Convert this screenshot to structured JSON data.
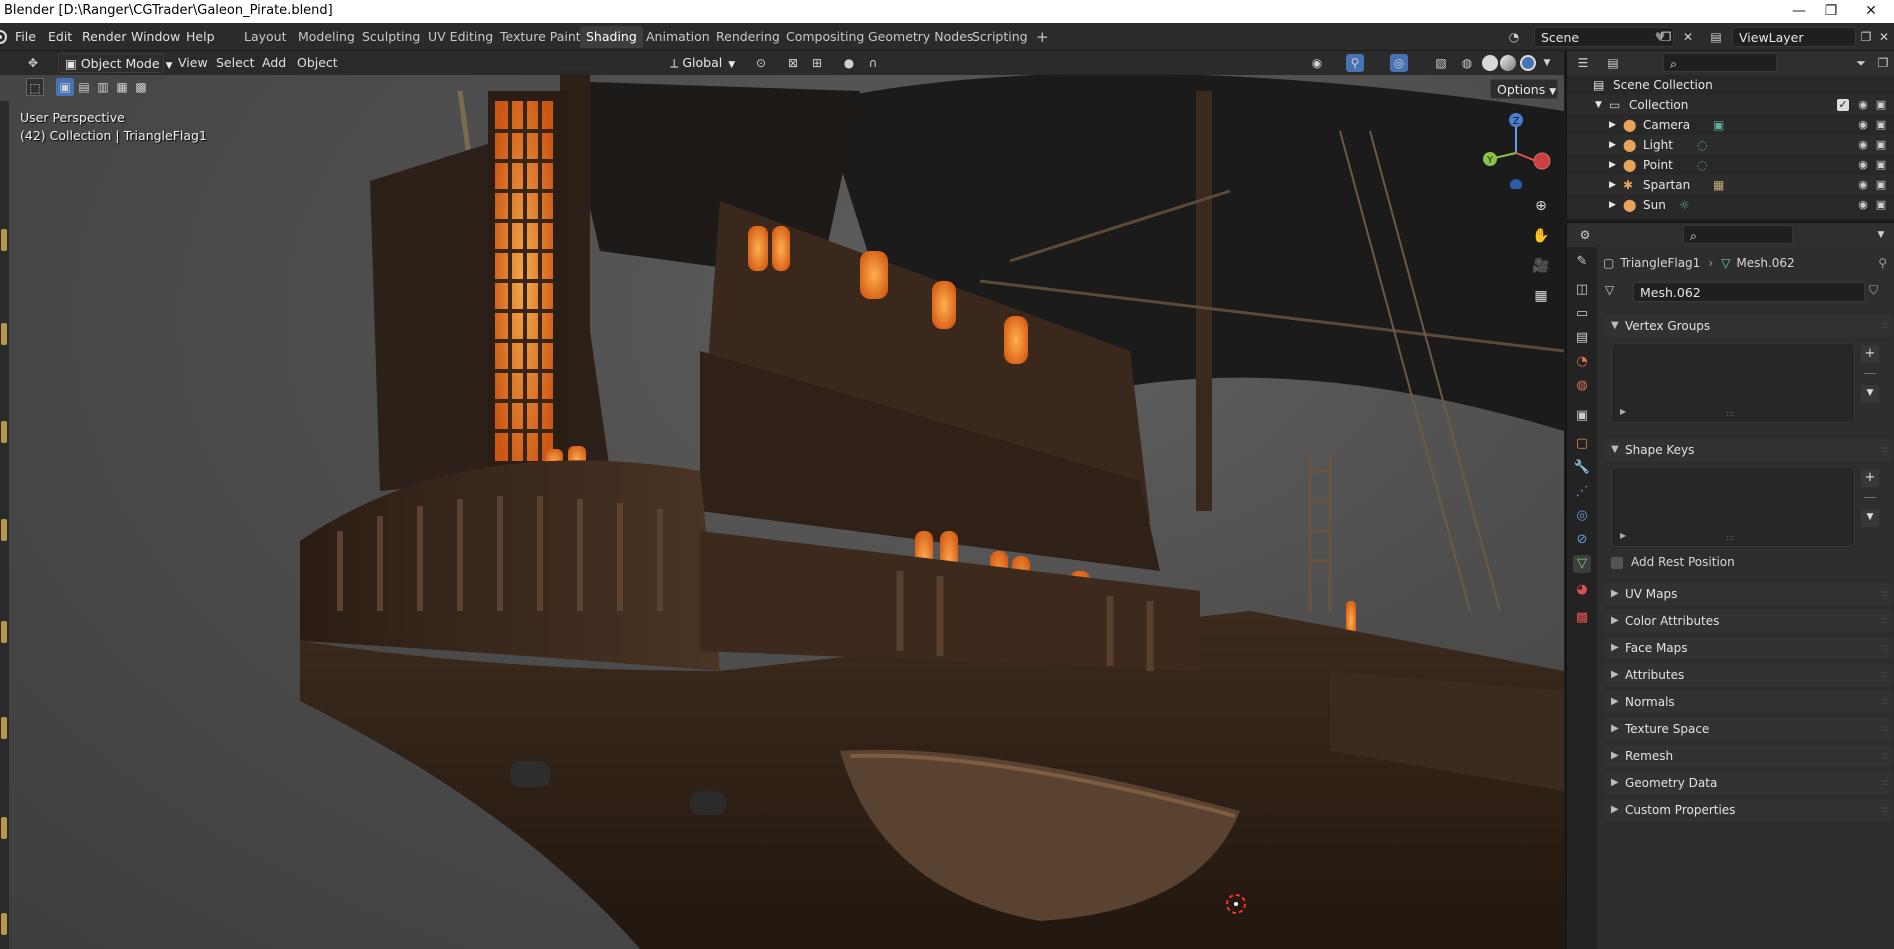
{
  "window": {
    "title": "Blender [D:\\Ranger\\CGTrader\\Galeon_Pirate.blend]",
    "minimize_glyph": "—",
    "maximize_glyph": "❐",
    "close_glyph": "✕"
  },
  "menubar": {
    "items": [
      "File",
      "Edit",
      "Render",
      "Window",
      "Help"
    ]
  },
  "workspaces": {
    "tabs": [
      "Layout",
      "Modeling",
      "Sculpting",
      "UV Editing",
      "Texture Paint",
      "Shading",
      "Animation",
      "Rendering",
      "Compositing",
      "Geometry Nodes",
      "Scripting"
    ],
    "active": "Shading",
    "add_glyph": "+"
  },
  "scene": {
    "name": "Scene"
  },
  "view_layer": {
    "name": "ViewLayer"
  },
  "viewport": {
    "mode": "Object Mode",
    "menus": [
      "View",
      "Select",
      "Add",
      "Object"
    ],
    "transform_orientation": "Global",
    "options_label": "Options",
    "overlay_line1": "User Perspective",
    "overlay_line2": "(42) Collection | TriangleFlag1",
    "gizmo": {
      "x_label": "",
      "y_label": "Y",
      "z_label": "Z"
    },
    "accent_color": "#4772b3"
  },
  "outliner": {
    "root": "Scene Collection",
    "collection": "Collection",
    "objects": [
      {
        "name": "Camera",
        "icon": "camera-data-icon"
      },
      {
        "name": "Light",
        "icon": "light-data-icon"
      },
      {
        "name": "Point",
        "icon": "light-data-icon"
      },
      {
        "name": "Spartan",
        "icon": "armature-data-icon"
      },
      {
        "name": "Sun",
        "icon": "sun-light-icon"
      }
    ]
  },
  "properties": {
    "breadcrumb_object": "TriangleFlag1",
    "breadcrumb_mesh": "Mesh.062",
    "mesh_datablock": "Mesh.062",
    "panels": {
      "vertex_groups": "Vertex Groups",
      "shape_keys": "Shape Keys",
      "add_rest_position": "Add Rest Position",
      "uv_maps": "UV Maps",
      "color_attributes": "Color Attributes",
      "face_maps": "Face Maps",
      "attributes": "Attributes",
      "normals": "Normals",
      "texture_space": "Texture Space",
      "remesh": "Remesh",
      "geometry_data": "Geometry Data",
      "custom_properties": "Custom Properties"
    }
  }
}
